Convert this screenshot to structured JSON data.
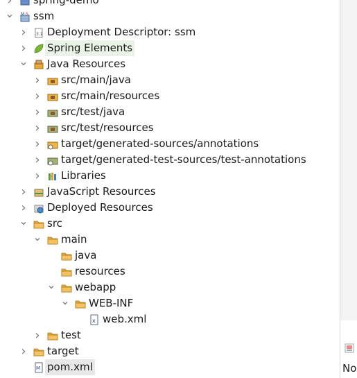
{
  "tree": {
    "items": [
      {
        "label": "spring-demo",
        "depth": 0,
        "chevron": "right",
        "icon": "project-icon"
      },
      {
        "label": "ssm",
        "depth": 0,
        "chevron": "down",
        "icon": "maven-project-icon"
      },
      {
        "label": "Deployment Descriptor: ssm",
        "depth": 1,
        "chevron": "right",
        "icon": "deployment-descriptor-icon"
      },
      {
        "label": "Spring Elements",
        "depth": 1,
        "chevron": "right",
        "icon": "spring-leaf-icon",
        "state": "hover"
      },
      {
        "label": "Java Resources",
        "depth": 1,
        "chevron": "down",
        "icon": "java-resources-icon"
      },
      {
        "label": "src/main/java",
        "depth": 2,
        "chevron": "right",
        "icon": "source-folder-icon"
      },
      {
        "label": "src/main/resources",
        "depth": 2,
        "chevron": "right",
        "icon": "source-folder-icon"
      },
      {
        "label": "src/test/java",
        "depth": 2,
        "chevron": "right",
        "icon": "test-source-folder-icon"
      },
      {
        "label": "src/test/resources",
        "depth": 2,
        "chevron": "right",
        "icon": "test-source-folder-icon"
      },
      {
        "label": "target/generated-sources/annotations",
        "depth": 2,
        "chevron": "right",
        "icon": "generated-source-folder-icon"
      },
      {
        "label": "target/generated-test-sources/test-annotations",
        "depth": 2,
        "chevron": "right",
        "icon": "generated-test-source-folder-icon"
      },
      {
        "label": "Libraries",
        "depth": 2,
        "chevron": "right",
        "icon": "libraries-icon"
      },
      {
        "label": "JavaScript Resources",
        "depth": 1,
        "chevron": "right",
        "icon": "javascript-resources-icon"
      },
      {
        "label": "Deployed Resources",
        "depth": 1,
        "chevron": "right",
        "icon": "deployed-resources-icon"
      },
      {
        "label": "src",
        "depth": 1,
        "chevron": "down",
        "icon": "folder-open-icon"
      },
      {
        "label": "main",
        "depth": 2,
        "chevron": "down",
        "icon": "folder-open-icon"
      },
      {
        "label": "java",
        "depth": 3,
        "chevron": "none",
        "icon": "folder-open-icon"
      },
      {
        "label": "resources",
        "depth": 3,
        "chevron": "none",
        "icon": "folder-open-icon"
      },
      {
        "label": "webapp",
        "depth": 3,
        "chevron": "down",
        "icon": "folder-open-icon"
      },
      {
        "label": "WEB-INF",
        "depth": 4,
        "chevron": "down",
        "icon": "folder-open-icon"
      },
      {
        "label": "web.xml",
        "depth": 5,
        "chevron": "none",
        "icon": "xml-file-icon"
      },
      {
        "label": "test",
        "depth": 2,
        "chevron": "right",
        "icon": "folder-open-icon"
      },
      {
        "label": "target",
        "depth": 1,
        "chevron": "right",
        "icon": "folder-open-icon"
      },
      {
        "label": "pom.xml",
        "depth": 1,
        "chevron": "none",
        "icon": "maven-pom-icon",
        "state": "selected"
      }
    ]
  },
  "right_panel": {
    "partial_text": "No"
  },
  "colors": {
    "folder": "#e6a83a",
    "package": "#8a5a2a",
    "test_folder": "#5d8a3a",
    "spring": "#7bb53a",
    "selected_bg": "#e8e8e8",
    "hover_bg": "#eaf4e6"
  }
}
